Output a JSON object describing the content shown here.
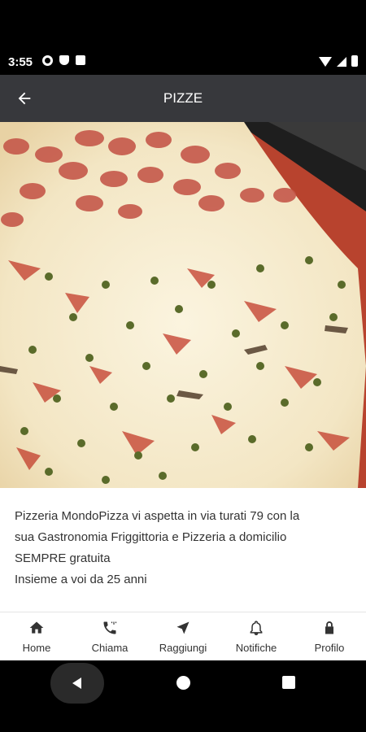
{
  "status_bar": {
    "time": "3:55",
    "left_icons": [
      "gear-icon",
      "shield-icon",
      "sd-card-icon"
    ],
    "right_icons": [
      "wifi-icon",
      "signal-icon",
      "battery-icon"
    ]
  },
  "app_bar": {
    "title": "PIZZE",
    "back_icon": "arrow-left-icon"
  },
  "hero_image": {
    "description_icon": "pizza-photo"
  },
  "content": {
    "lines": [
      "Pizzeria MondoPizza vi aspetta in via turati 79 con la",
      "sua Gastronomia Friggittoria e Pizzeria a domicilio",
      "SEMPRE gratuita",
      "Insieme a voi da 25 anni"
    ]
  },
  "bottom_nav": {
    "items": [
      {
        "label": "Home",
        "icon": "home-icon"
      },
      {
        "label": "Chiama",
        "icon": "phone-icon"
      },
      {
        "label": "Raggiungi",
        "icon": "navigation-icon"
      },
      {
        "label": "Notifiche",
        "icon": "bell-icon"
      },
      {
        "label": "Profilo",
        "icon": "lock-icon"
      }
    ]
  },
  "colors": {
    "app_bar": "#37383c",
    "text": "#333333",
    "background": "#ffffff"
  }
}
